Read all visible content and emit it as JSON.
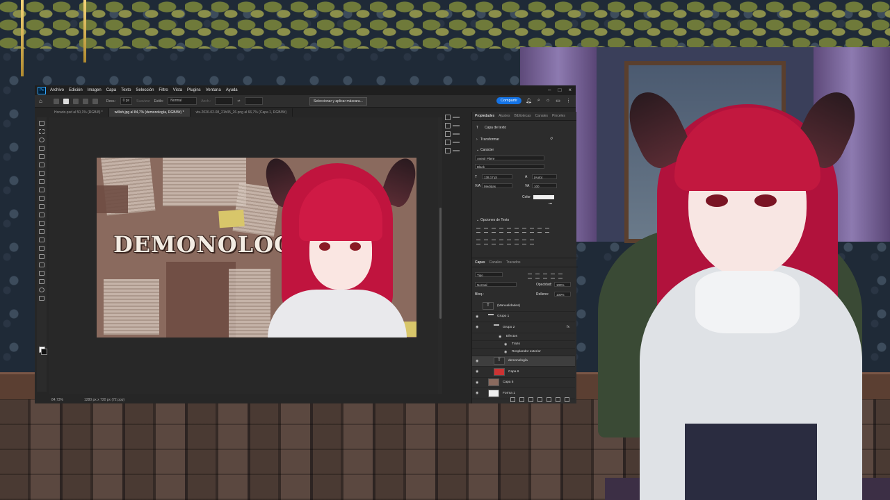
{
  "photoshop": {
    "logo": "Ps",
    "menu": [
      "Archivo",
      "Edición",
      "Imagen",
      "Capa",
      "Texto",
      "Selección",
      "Filtro",
      "Vista",
      "Plugins",
      "Ventana",
      "Ayuda"
    ],
    "options": {
      "feather_label": "Desv.:",
      "feather_value": "0 px",
      "smooth_label": "Suavizar",
      "style_label": "Estilo:",
      "style_value": "Normal",
      "width_label": "Anch.:",
      "select_mask_button": "Seleccionar y aplicar máscara..."
    },
    "share_button": "Compartir",
    "tabs": [
      {
        "label": "Horario.psd al 50,1% (RGB/8) *",
        "active": false
      },
      {
        "label": "willish.jpg al 84,7% (demonología, RGB/8#) *",
        "active": true
      },
      {
        "label": "vts-2026-02-08_21h35_26.png al 66,7% (Capa 1, RGB/8#)",
        "active": false
      }
    ],
    "canvas": {
      "title_text": "DEMONOLOGÍA"
    },
    "status": {
      "zoom": "84,73%",
      "size": "1280 px x 720 px (72 ppp)"
    },
    "properties_panel": {
      "tabs": [
        {
          "label": "Propiedades",
          "active": true
        },
        {
          "label": "Ajustes",
          "active": false
        },
        {
          "label": "Bibliotecas",
          "active": false
        },
        {
          "label": "Canales",
          "active": false
        },
        {
          "label": "Pinceles",
          "active": false
        }
      ],
      "layer_type": "Capa de texto",
      "transform_header": "Transformar",
      "character_header": "Carácter",
      "font_family": "Avenir Pliere",
      "font_style": "Black",
      "font_size": "138,17 pt",
      "leading": "(Auto)",
      "kerning": "Medidas",
      "tracking": "100",
      "color_label": "Color",
      "text_options_header": "Opciones de Texto"
    },
    "layers_panel": {
      "tabs": [
        {
          "label": "Capas",
          "active": true
        },
        {
          "label": "Canales",
          "active": false
        },
        {
          "label": "Trazados",
          "active": false
        }
      ],
      "filter_value": "Tipo",
      "blend_mode": "Normal",
      "opacity_label": "Opacidad:",
      "opacity_value": "100%",
      "lock_label": "Bloq.:",
      "fill_label": "Relleno:",
      "fill_value": "100%",
      "layers": [
        {
          "name": "(Manualidades)",
          "kind": "text",
          "visible": false,
          "selected": false
        },
        {
          "name": "Grupo 1",
          "kind": "folder",
          "visible": true,
          "selected": false
        },
        {
          "name": "Grupo 2",
          "kind": "folder",
          "visible": true,
          "selected": false,
          "fx": "fx"
        },
        {
          "name": "Efectos",
          "kind": "effect",
          "visible": true,
          "selected": false
        },
        {
          "name": "Trazo",
          "kind": "effect",
          "visible": true,
          "selected": false
        },
        {
          "name": "Resplandor exterior",
          "kind": "effect",
          "visible": true,
          "selected": false
        },
        {
          "name": "demonología",
          "kind": "text",
          "visible": true,
          "selected": true
        },
        {
          "name": "Capa 6",
          "kind": "image",
          "visible": true,
          "selected": false
        },
        {
          "name": "Capa 5",
          "kind": "image",
          "visible": true,
          "selected": false
        },
        {
          "name": "Forma 1",
          "kind": "image",
          "visible": true,
          "selected": false
        }
      ]
    }
  },
  "colors": {
    "accent": "#1473e6",
    "hair": "#c0143e",
    "ps_bg": "#262626"
  }
}
